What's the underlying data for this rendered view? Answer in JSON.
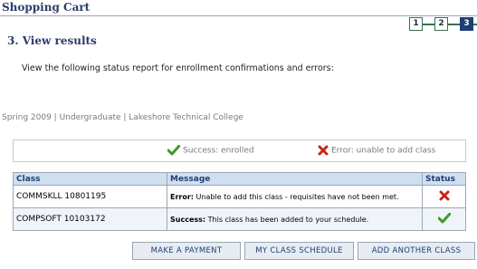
{
  "header": {
    "title": "Shopping Cart"
  },
  "steps": [
    "1",
    "2",
    "3"
  ],
  "step_heading": "3.  View results",
  "instructions": "View the following status report for enrollment confirmations and errors:",
  "term_info": "Spring 2009 | Undergraduate | Lakeshore Technical College",
  "legend": {
    "success_label": "Success: enrolled",
    "error_label": "Error: unable to add class",
    "success_icon": "checkmark-icon",
    "error_icon": "x-icon"
  },
  "results": {
    "columns": [
      "Class",
      "Message",
      "Status"
    ],
    "rows": [
      {
        "class": "COMMSKLL 10801195",
        "message_prefix": "Error:",
        "message_text": " Unable to add this class - requisites have not been met.",
        "status": "error"
      },
      {
        "class": "COMPSOFT 10103172",
        "message_prefix": "Success:",
        "message_text": " This class has been added to your schedule.",
        "status": "success"
      }
    ]
  },
  "buttons": {
    "payment": "MAKE A PAYMENT",
    "schedule": "MY CLASS SCHEDULE",
    "add_another": "ADD ANOTHER CLASS"
  },
  "colors": {
    "brand": "#2b3c6a",
    "header_bg": "#cfdff0",
    "success": "#3f9a2a",
    "error": "#c8241a"
  }
}
